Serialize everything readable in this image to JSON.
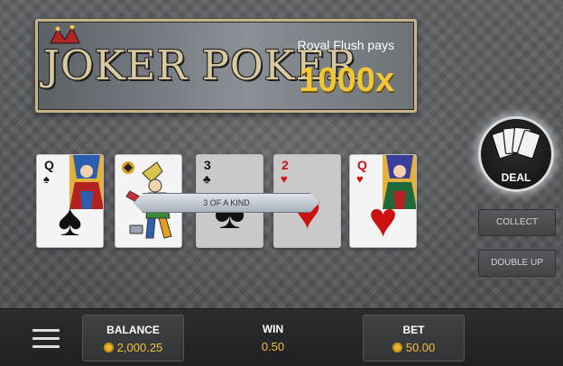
{
  "banner": {
    "logo_text": "JOKER POKER",
    "promo_label": "Royal Flush pays",
    "promo_value": "1000x"
  },
  "cards": [
    {
      "rank": "Q",
      "suit": "♠",
      "color": "black",
      "face": true,
      "held": false
    },
    {
      "rank": "",
      "suit": "",
      "color": "black",
      "joker": true,
      "held": false
    },
    {
      "rank": "3",
      "suit": "♣",
      "color": "black",
      "face": false,
      "held": true
    },
    {
      "rank": "2",
      "suit": "♥",
      "color": "red",
      "face": false,
      "held": true
    },
    {
      "rank": "Q",
      "suit": "♥",
      "color": "red",
      "face": true,
      "held": false
    }
  ],
  "result_text": "3 OF A KIND",
  "controls": {
    "deal_label": "DEAL",
    "collect_label": "COLLECT",
    "double_up_label": "DOUBLE UP"
  },
  "status": {
    "balance_label": "BALANCE",
    "balance_value": "2,000.25",
    "win_label": "WIN",
    "win_value": "0.50",
    "bet_label": "BET",
    "bet_value": "50.00"
  },
  "colors": {
    "accent_gold": "#f0c63a",
    "card_red": "#cc1111",
    "card_black": "#111111"
  }
}
